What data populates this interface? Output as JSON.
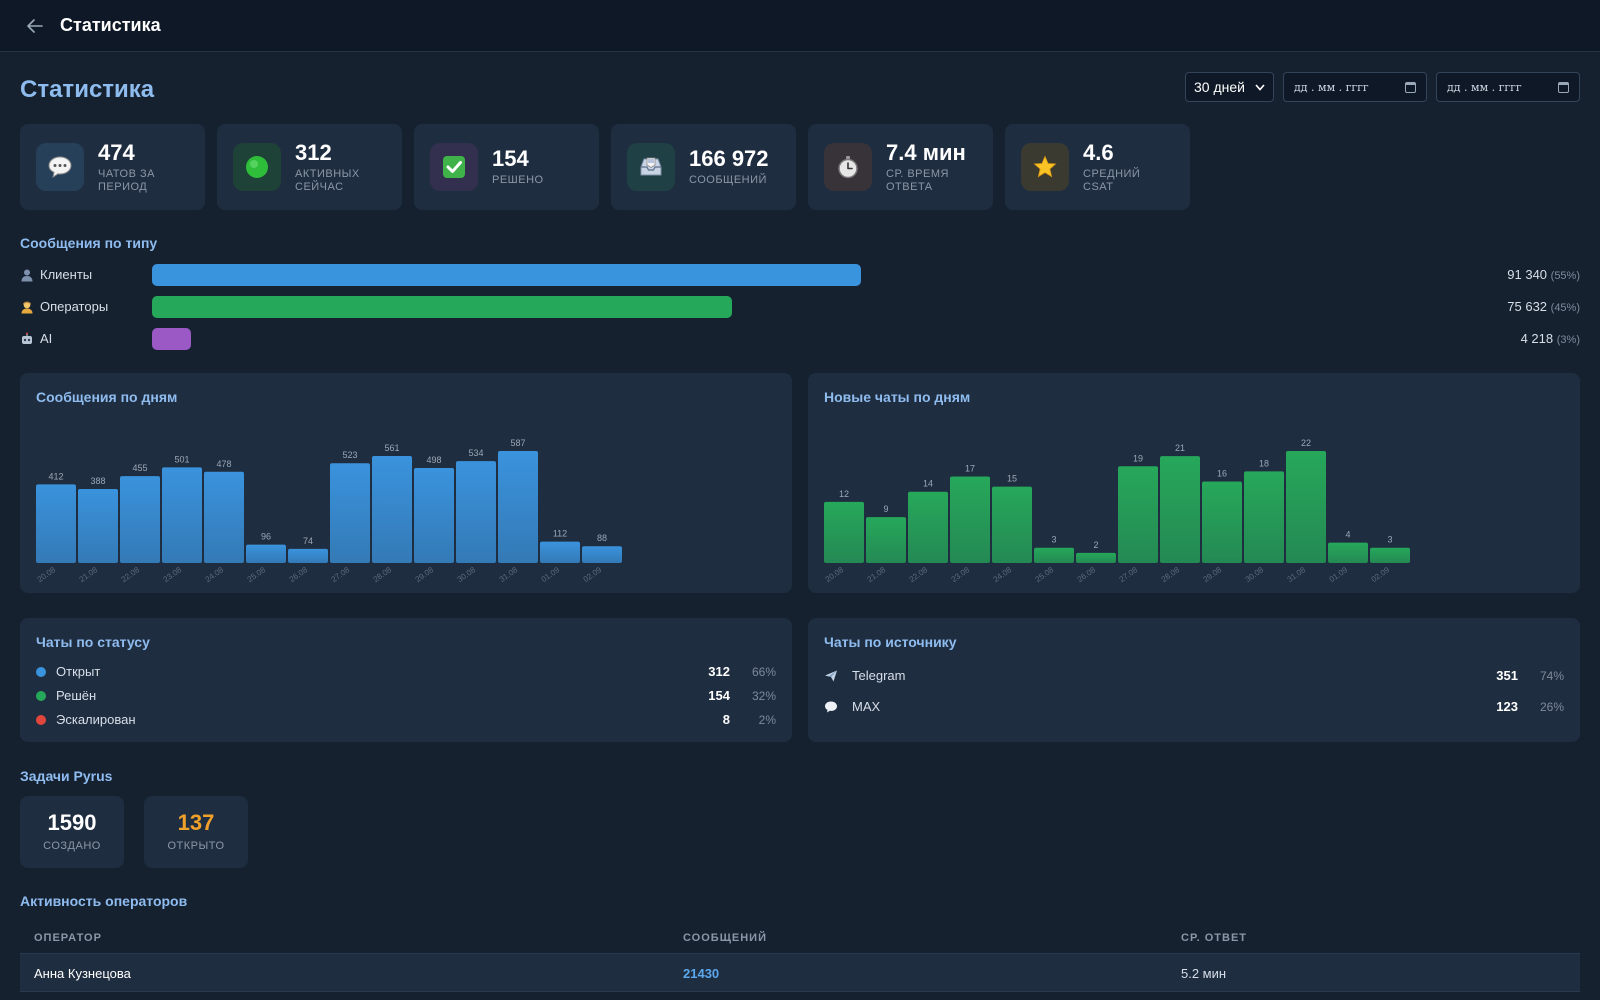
{
  "topbar": {
    "title": "Статистика"
  },
  "page": {
    "title": "Статистика"
  },
  "filters": {
    "period": "30 дней",
    "date_from_placeholder": "дд . мм . гггг",
    "date_to_placeholder": "дд . мм . гггг"
  },
  "stats": [
    {
      "value": "474",
      "label": "Чатов за период",
      "icon": "speech-bubble-icon",
      "bg": "#26405a"
    },
    {
      "value": "312",
      "label": "Активных сейчас",
      "icon": "green-circle-icon",
      "bg": "#1f4238"
    },
    {
      "value": "154",
      "label": "Решено",
      "icon": "check-mark-icon",
      "bg": "#33304f"
    },
    {
      "value": "166 972",
      "label": "Сообщений",
      "icon": "inbox-tray-icon",
      "bg": "#1f4044"
    },
    {
      "value": "7.4 мин",
      "label": "Ср. время ответа",
      "icon": "stopwatch-icon",
      "bg": "#373338"
    },
    {
      "value": "4.6",
      "label": "Средний CSAT",
      "icon": "star-icon",
      "bg": "#3a3a31"
    }
  ],
  "messages_by_type": {
    "title": "Сообщения по типу",
    "items": [
      {
        "label": "Клиенты",
        "value": "91 340",
        "pct": "(55%)",
        "fraction": 0.545,
        "color": "#3a93dd",
        "icon": "person-icon"
      },
      {
        "label": "Операторы",
        "value": "75 632",
        "pct": "(45%)",
        "fraction": 0.446,
        "color": "#26a85a",
        "icon": "operator-icon"
      },
      {
        "label": "AI",
        "value": "4 218",
        "pct": "(3%)",
        "fraction": 0.03,
        "color": "#9b59c6",
        "icon": "robot-icon"
      }
    ]
  },
  "messages_by_day": {
    "title": "Сообщения по дням",
    "chart_data": {
      "type": "bar",
      "color": "#3a93dd",
      "values": [
        412,
        388,
        455,
        501,
        478,
        96,
        74,
        523,
        561,
        498,
        534,
        587,
        112,
        88
      ],
      "categories": [
        "20.08",
        "21.08",
        "22.08",
        "23.08",
        "24.08",
        "25.08",
        "26.08",
        "27.08",
        "28.08",
        "29.08",
        "30.08",
        "31.08",
        "01.09",
        "02.09"
      ]
    }
  },
  "new_chats_by_day": {
    "title": "Новые чаты по дням",
    "chart_data": {
      "type": "bar",
      "color": "#26a85a",
      "values": [
        12,
        9,
        14,
        17,
        15,
        3,
        2,
        19,
        21,
        16,
        18,
        22,
        4,
        3
      ],
      "categories": [
        "20.08",
        "21.08",
        "22.08",
        "23.08",
        "24.08",
        "25.08",
        "26.08",
        "27.08",
        "28.08",
        "29.08",
        "30.08",
        "31.08",
        "01.09",
        "02.09"
      ]
    }
  },
  "chats_by_status": {
    "title": "Чаты по статусу",
    "items": [
      {
        "label": "Открыт",
        "count": "312",
        "pct": "66%",
        "color": "#3a93dd"
      },
      {
        "label": "Решён",
        "count": "154",
        "pct": "32%",
        "color": "#26a85a"
      },
      {
        "label": "Эскалирован",
        "count": "8",
        "pct": "2%",
        "color": "#e0463c"
      }
    ]
  },
  "chats_by_source": {
    "title": "Чаты по источнику",
    "items": [
      {
        "label": "Telegram",
        "count": "351",
        "pct": "74%",
        "icon": "airplane-icon"
      },
      {
        "label": "MAX",
        "count": "123",
        "pct": "26%",
        "icon": "chat-bubble-icon"
      }
    ]
  },
  "pyrus": {
    "title": "Задачи Pyrus",
    "created": {
      "value": "1590",
      "label": "СОЗДАНО"
    },
    "open": {
      "value": "137",
      "label": "ОТКРЫТО"
    }
  },
  "operators": {
    "title": "Активность операторов",
    "columns": [
      "ОПЕРАТОР",
      "СООБЩЕНИЙ",
      "СР. ОТВЕТ"
    ],
    "rows": [
      {
        "name": "Анна Кузнецова",
        "messages": "21430",
        "avg": "5.2 мин"
      }
    ]
  }
}
